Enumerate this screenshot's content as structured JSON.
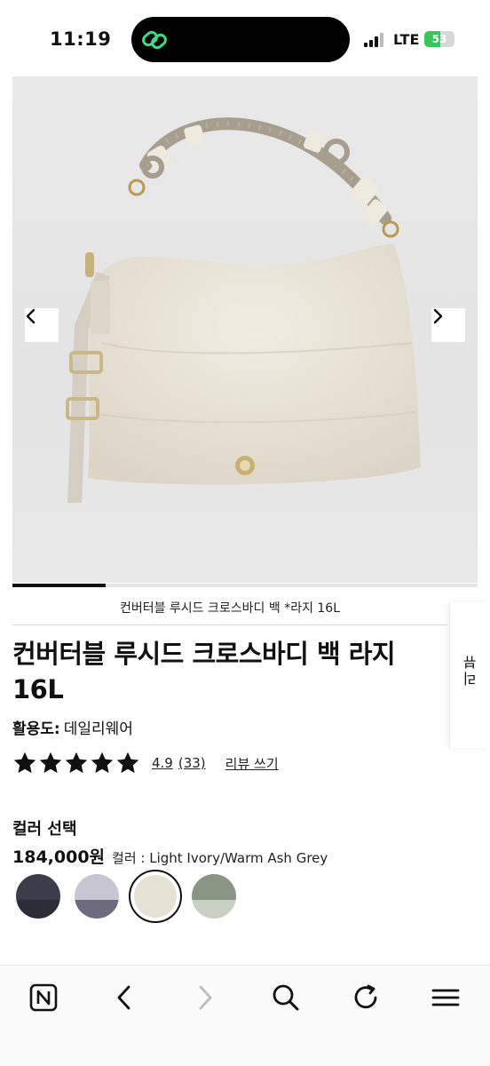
{
  "status_bar": {
    "time": "11:19",
    "network": "LTE",
    "battery_percent": "53",
    "battery_level": 0.53
  },
  "gallery": {
    "image": "product-photo-ivory-bag",
    "prev_icon": "chevron-left-icon",
    "next_icon": "chevron-right-icon",
    "progress": 0.2
  },
  "product": {
    "caption": "컨버터블 루시드 크로스바디 백 *라지 16L",
    "title": "컨버터블 루시드 크로스바디 백 라지 16L",
    "usage_label": "활용도:",
    "usage_value": "데일리웨어",
    "rating": "4.9",
    "review_count": "(33)",
    "write_review": "리뷰 쓰기",
    "stars": 5
  },
  "side_tab": {
    "label": "리뷰"
  },
  "color_select": {
    "heading": "컬러 선택",
    "price": "184,000원",
    "color_label": "컬러 : Light Ivory/Warm Ash Grey",
    "swatches": [
      {
        "name": "dark-navy-logo",
        "top": "#3b3d4a",
        "bottom": "#2b2d38"
      },
      {
        "name": "lavender-grey",
        "top": "#c9c6d3",
        "bottom": "#6e6a80"
      },
      {
        "name": "light-ivory-warm-ash-grey",
        "top": "#e6e1d5",
        "bottom": "#d8d2c4",
        "selected": true
      },
      {
        "name": "sage-green",
        "top": "#8a9585",
        "bottom": "#c9d0c3"
      }
    ]
  },
  "toolbar": {
    "items": [
      "naver-home-icon",
      "back-icon",
      "forward-icon",
      "search-icon",
      "refresh-icon",
      "menu-icon"
    ]
  },
  "colors": {
    "accent": "#111111",
    "island_icon": "#3ddc84",
    "battery": "#34c759"
  }
}
